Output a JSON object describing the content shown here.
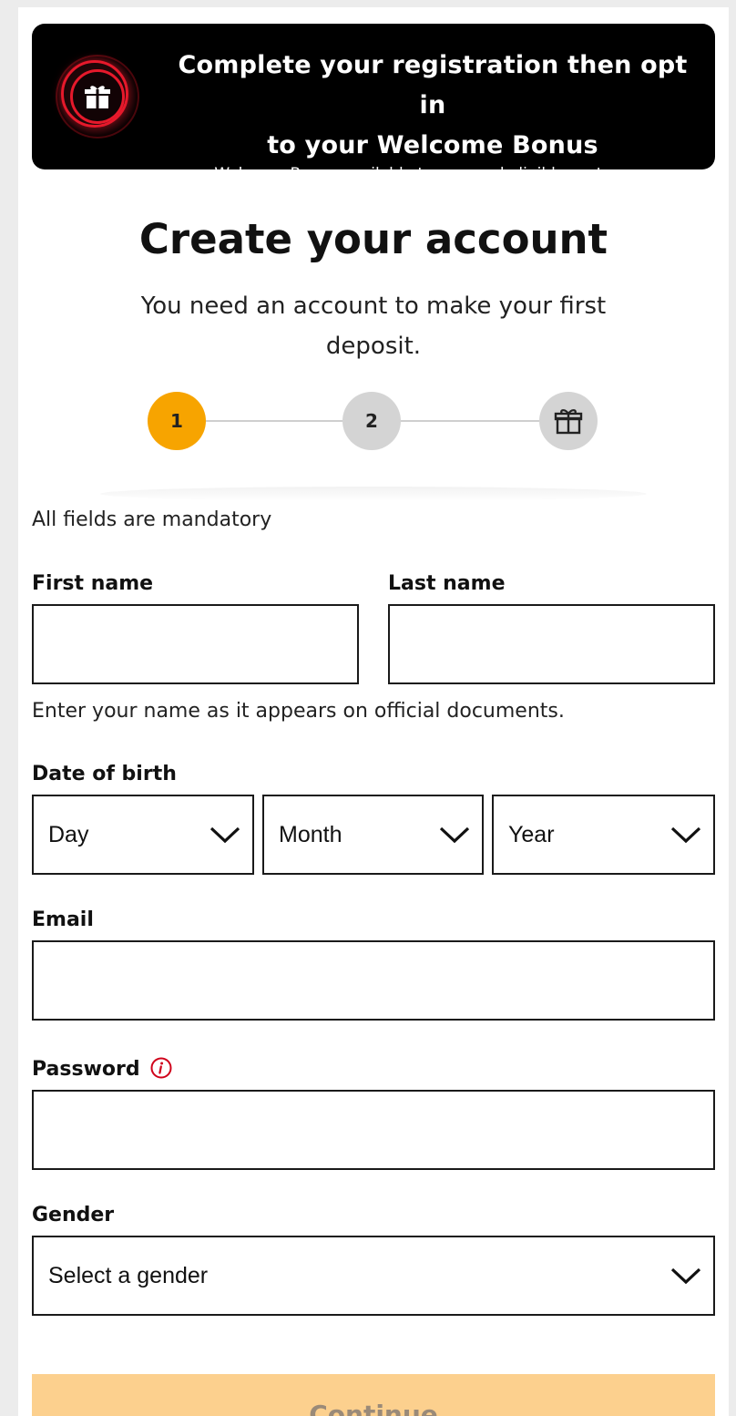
{
  "banner": {
    "title_line1": "Complete your registration then opt in",
    "title_line2": "to your Welcome Bonus",
    "subtitle": "Welcome Bonus available to new and eligible customers",
    "icon": "gift-icon"
  },
  "heading": "Create your account",
  "subheading": "You need an account to make your first deposit.",
  "stepper": {
    "steps": [
      {
        "label": "1",
        "state": "active"
      },
      {
        "label": "2",
        "state": "inactive"
      },
      {
        "label": "",
        "icon": "gift-icon",
        "state": "inactive"
      }
    ],
    "active_color": "#f7a400",
    "inactive_color": "#d4d4d4"
  },
  "form": {
    "mandatory_note": "All fields are mandatory",
    "first_name": {
      "label": "First name",
      "value": "",
      "placeholder": ""
    },
    "last_name": {
      "label": "Last name",
      "value": "",
      "placeholder": ""
    },
    "name_hint": "Enter your name as it appears on official documents.",
    "dob": {
      "label": "Date of birth",
      "day": "Day",
      "month": "Month",
      "year": "Year"
    },
    "email": {
      "label": "Email",
      "value": "",
      "placeholder": ""
    },
    "password": {
      "label": "Password",
      "value": "",
      "placeholder": "",
      "info_icon": "info-icon"
    },
    "gender": {
      "label": "Gender",
      "selected": "Select a gender"
    },
    "continue_label": "Continue",
    "continue_color": "#fcd08e"
  }
}
